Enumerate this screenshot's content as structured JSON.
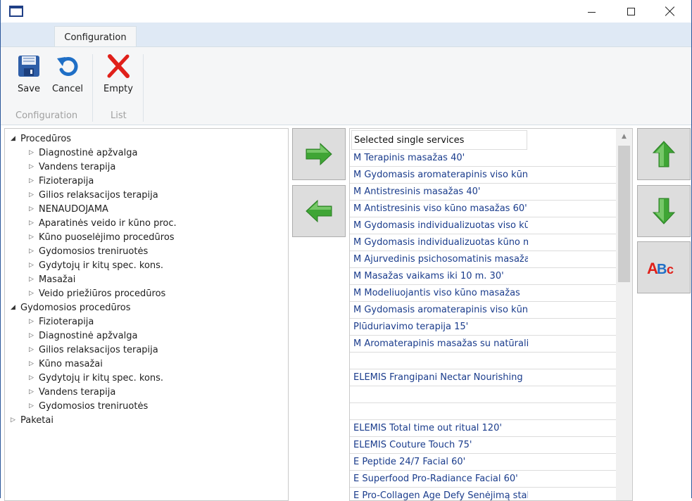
{
  "window": {
    "title": ""
  },
  "ribbon": {
    "tab_label": "Configuration",
    "buttons": {
      "save": "Save",
      "cancel": "Cancel",
      "empty": "Empty"
    },
    "groups": {
      "configuration": "Configuration",
      "list": "List"
    }
  },
  "tree": {
    "groups": [
      {
        "label": "Procedūros",
        "expanded": true,
        "children": [
          "Diagnostinė apžvalga",
          "Vandens terapija",
          "Fizioterapija",
          "Gilios relaksacijos terapija",
          "NENAUDOJAMA",
          "Aparatinės veido ir kūno proc.",
          "Kūno puoselėjimo procedūros",
          "Gydomosios treniruotės",
          "Gydytojų ir kitų spec. kons.",
          "Masažai",
          "Veido priežiūros procedūros"
        ]
      },
      {
        "label": "Gydomosios procedūros",
        "expanded": true,
        "children": [
          "Fizioterapija",
          "Diagnostinė apžvalga",
          "Gilios relaksacijos terapija",
          "Kūno masažai",
          "Gydytojų ir kitų spec. kons.",
          "Vandens terapija",
          "Gydomosios treniruotės"
        ]
      },
      {
        "label": "Paketai",
        "expanded": false,
        "children": []
      }
    ]
  },
  "list": {
    "header": "Selected single services",
    "rows": [
      "M Terapinis masažas 40'",
      "M Gydomasis aromaterapinis viso kūno",
      "M Antistresinis masažas 40'",
      "M Antistresinis viso kūno masažas 60'",
      "M Gydomasis individualizuotas viso kūno",
      "M Gydomasis individualizuotas kūno masažas",
      "M Ajurvedinis psichosomatinis masažas",
      "M Masažas vaikams iki 10 m. 30'",
      "M Modeliuojantis viso kūno masažas",
      "M Gydomasis aromaterapinis viso kūno",
      "Plūduriavimo terapija 15'",
      "M Aromaterapinis masažas su natūraliais",
      "",
      "ELEMIS Frangipani Nectar Nourishing",
      "",
      "",
      "ELEMIS Total time out ritual 120'",
      "ELEMIS Couture Touch 75'",
      "E Peptide 24/7 Facial 60'",
      "E Superfood Pro-Radiance Facial 60'",
      "E Pro-Collagen Age Defy Senėjimą stabdanti"
    ]
  },
  "side_buttons": {
    "abc_label": "ABC"
  },
  "colors": {
    "accent": "#2b579a",
    "arrow_green": "#3fa535",
    "remove_red": "#e0201a"
  }
}
